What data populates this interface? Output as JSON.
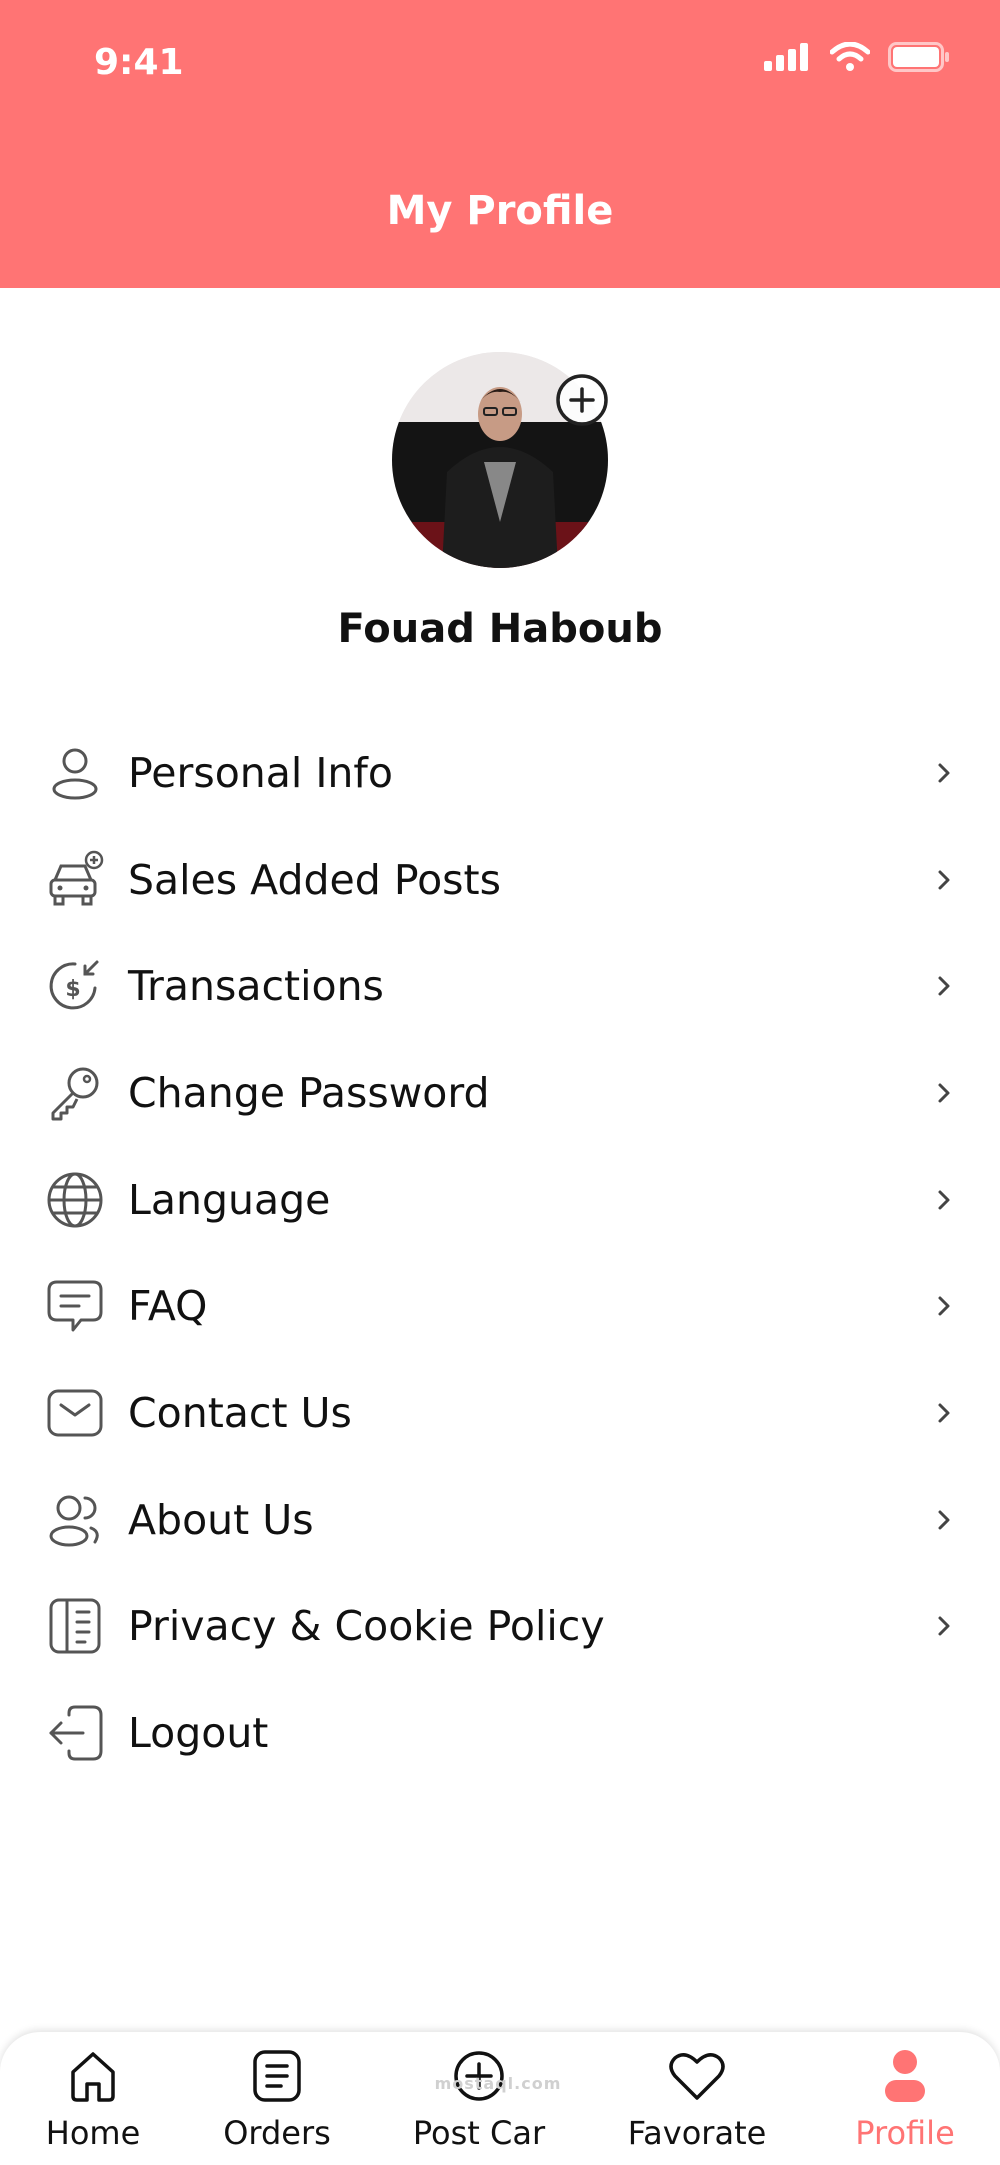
{
  "status_bar": {
    "time": "9:41"
  },
  "header": {
    "title": "My Profile",
    "background_color": "#FF7474"
  },
  "profile": {
    "name": "Fouad Haboub",
    "avatar_action_icon": "plus-circle-icon"
  },
  "menu": {
    "items": [
      {
        "label": "Personal Info",
        "icon": "user-icon",
        "has_chevron": true
      },
      {
        "label": "Sales Added Posts",
        "icon": "car-add-icon",
        "has_chevron": true
      },
      {
        "label": "Transactions",
        "icon": "dollar-in-icon",
        "has_chevron": true
      },
      {
        "label": "Change Password",
        "icon": "key-icon",
        "has_chevron": true
      },
      {
        "label": "Language",
        "icon": "globe-icon",
        "has_chevron": true
      },
      {
        "label": "FAQ",
        "icon": "chat-bubble-icon",
        "has_chevron": true
      },
      {
        "label": "Contact Us",
        "icon": "envelope-icon",
        "has_chevron": true
      },
      {
        "label": "About Us",
        "icon": "users-icon",
        "has_chevron": true
      },
      {
        "label": "Privacy & Cookie Policy",
        "icon": "document-icon",
        "has_chevron": true
      },
      {
        "label": "Logout",
        "icon": "logout-icon",
        "has_chevron": false
      }
    ]
  },
  "tabbar": {
    "active_color": "#FF7474",
    "tabs": [
      {
        "label": "Home",
        "icon": "home-icon",
        "active": false
      },
      {
        "label": "Orders",
        "icon": "orders-icon",
        "active": false
      },
      {
        "label": "Post Car",
        "icon": "plus-circle-icon",
        "active": false
      },
      {
        "label": "Favorate",
        "icon": "heart-icon",
        "active": false
      },
      {
        "label": "Profile",
        "icon": "profile-icon",
        "active": true
      }
    ]
  },
  "watermark": {
    "text": "mostaql.com"
  }
}
